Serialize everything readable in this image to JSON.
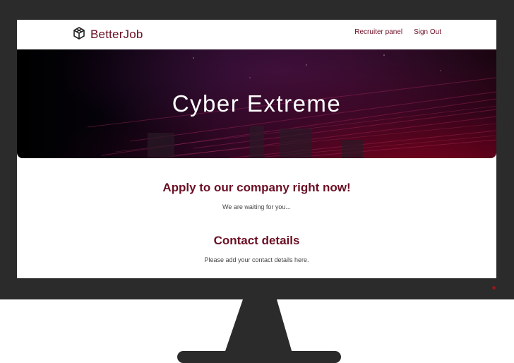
{
  "brand": {
    "name": "BetterJob",
    "logo_icon": "box-icon"
  },
  "nav": {
    "links": [
      {
        "label": "Recruiter panel"
      },
      {
        "label": "Sign Out"
      }
    ]
  },
  "hero": {
    "title": "Cyber Extreme"
  },
  "apply": {
    "title": "Apply to our company right now!",
    "subtitle": "We are waiting for you..."
  },
  "contact": {
    "title": "Contact details",
    "subtitle": "Please add your contact details here."
  },
  "colors": {
    "accent": "#6b0f24",
    "bezel": "#2b2b2b"
  }
}
